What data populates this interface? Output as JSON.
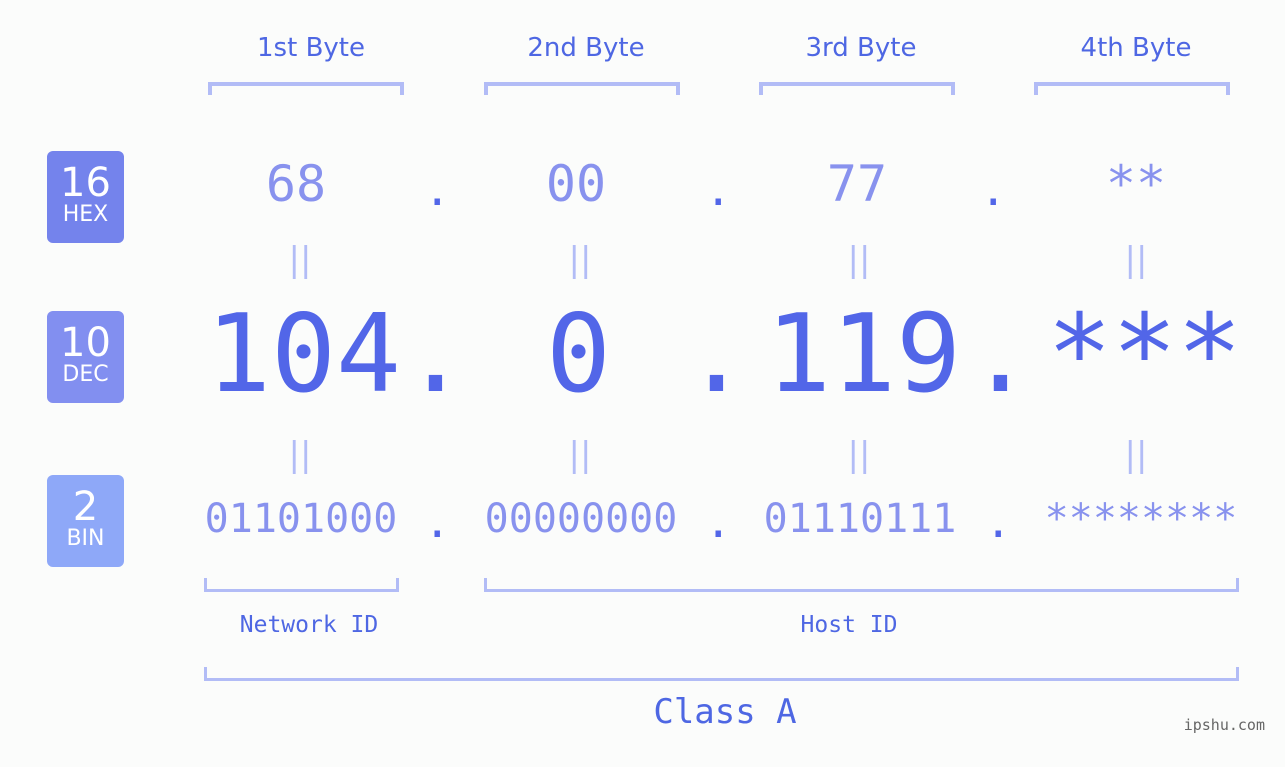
{
  "bytes": {
    "labels": [
      "1st Byte",
      "2nd Byte",
      "3rd Byte",
      "4th Byte"
    ]
  },
  "badges": {
    "hex": {
      "num": "16",
      "label": "HEX",
      "color": "#7483ec"
    },
    "dec": {
      "num": "10",
      "label": "DEC",
      "color": "#828ff0"
    },
    "bin": {
      "num": "2",
      "label": "BIN",
      "color": "#8ea8f8"
    }
  },
  "hex": {
    "values": [
      "68",
      "00",
      "77",
      "**"
    ]
  },
  "dec": {
    "values": [
      "104",
      "0",
      "119",
      "***"
    ]
  },
  "bin": {
    "values": [
      "01101000",
      "00000000",
      "01110111",
      "********"
    ]
  },
  "separator": ".",
  "equals": "||",
  "network_id_label": "Network ID",
  "host_id_label": "Host ID",
  "class_label": "Class A",
  "watermark": "ipshu.com",
  "colors": {
    "primary": "#5266e8",
    "light": "#8892ee",
    "bracket": "#b2bcf6",
    "label": "#4e67e3"
  }
}
